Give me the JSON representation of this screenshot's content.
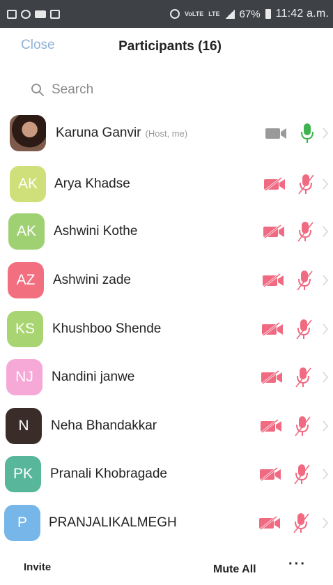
{
  "status_bar": {
    "battery": "67%",
    "time": "11:42 a.m.",
    "volte": "VoLTE",
    "lte": "LTE"
  },
  "header": {
    "close_label": "Close",
    "title": "Participants (16)"
  },
  "search": {
    "placeholder": "Search"
  },
  "participants": [
    {
      "initials": "",
      "name": "Karuna Ganvir",
      "tag": "(Host, me)",
      "avatar": "photo",
      "video": "off-gray",
      "mic": "on"
    },
    {
      "initials": "AK",
      "name": "Arya Khadse",
      "tag": "",
      "avatar_color": "#cfe07a",
      "video": "off",
      "mic": "muted"
    },
    {
      "initials": "AK",
      "name": "Ashwini Kothe",
      "tag": "",
      "avatar_color": "#9fd173",
      "video": "off",
      "mic": "muted"
    },
    {
      "initials": "AZ",
      "name": "Ashwini zade",
      "tag": "",
      "avatar_color": "#f26f7f",
      "video": "off",
      "mic": "muted"
    },
    {
      "initials": "KS",
      "name": "Khushboo Shende",
      "tag": "",
      "avatar_color": "#a8d572",
      "video": "off",
      "mic": "muted"
    },
    {
      "initials": "NJ",
      "name": "Nandini janwe",
      "tag": "",
      "avatar_color": "#f6a8d6",
      "video": "off",
      "mic": "muted"
    },
    {
      "initials": "N",
      "name": "Neha Bhandakkar",
      "tag": "",
      "avatar_color": "#3a2c28",
      "video": "off",
      "mic": "muted"
    },
    {
      "initials": "PK",
      "name": "Pranali Khobragade",
      "tag": "",
      "avatar_color": "#58b69a",
      "video": "off",
      "mic": "muted"
    },
    {
      "initials": "P",
      "name": "PRANJALIKALMEGH",
      "tag": "",
      "avatar_color": "#76b6e8",
      "video": "off",
      "mic": "muted"
    }
  ],
  "toolbar": {
    "invite_label": "Invite",
    "mute_all_label": "Mute All",
    "more_label": "···"
  },
  "colors": {
    "muted_red": "#f06a82",
    "mic_on_green": "#3fb34f",
    "video_gray": "#9a9a9a",
    "close_blue": "#8fb1d8"
  }
}
